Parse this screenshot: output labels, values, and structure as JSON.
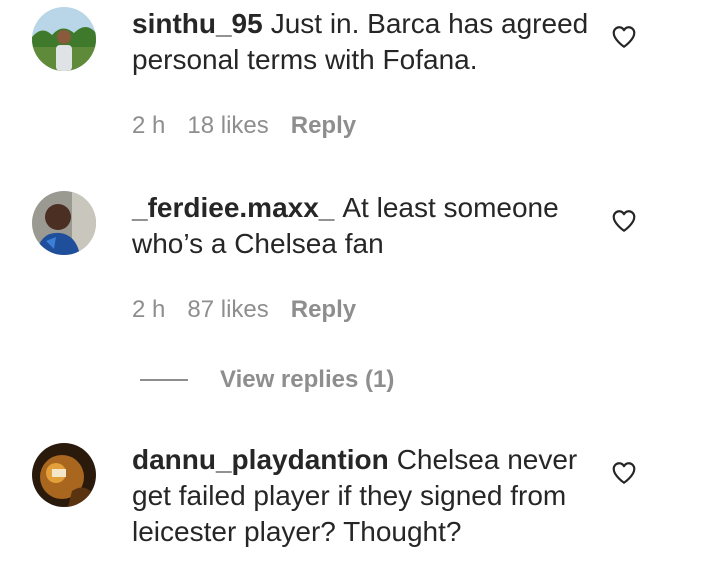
{
  "comments": [
    {
      "username": "sinthu_95",
      "text": "Just in. Barca has agreed personal terms with Fofana.",
      "time": "2 h",
      "likes": "18 likes",
      "reply": "Reply"
    },
    {
      "username": "_ferdiee.maxx_",
      "text": "At least someone who’s a Chelsea fan",
      "time": "2 h",
      "likes": "87 likes",
      "reply": "Reply"
    },
    {
      "username": "dannu_playdantion",
      "text": "Chelsea never get failed player if they signed from leicester player? Thought?"
    }
  ],
  "view_replies": "View replies (1)",
  "icons": {
    "like": "heart-outline-icon",
    "avatar": "avatar"
  },
  "colors": {
    "primary_text": "#262626",
    "secondary_text": "#8e8e8e"
  }
}
